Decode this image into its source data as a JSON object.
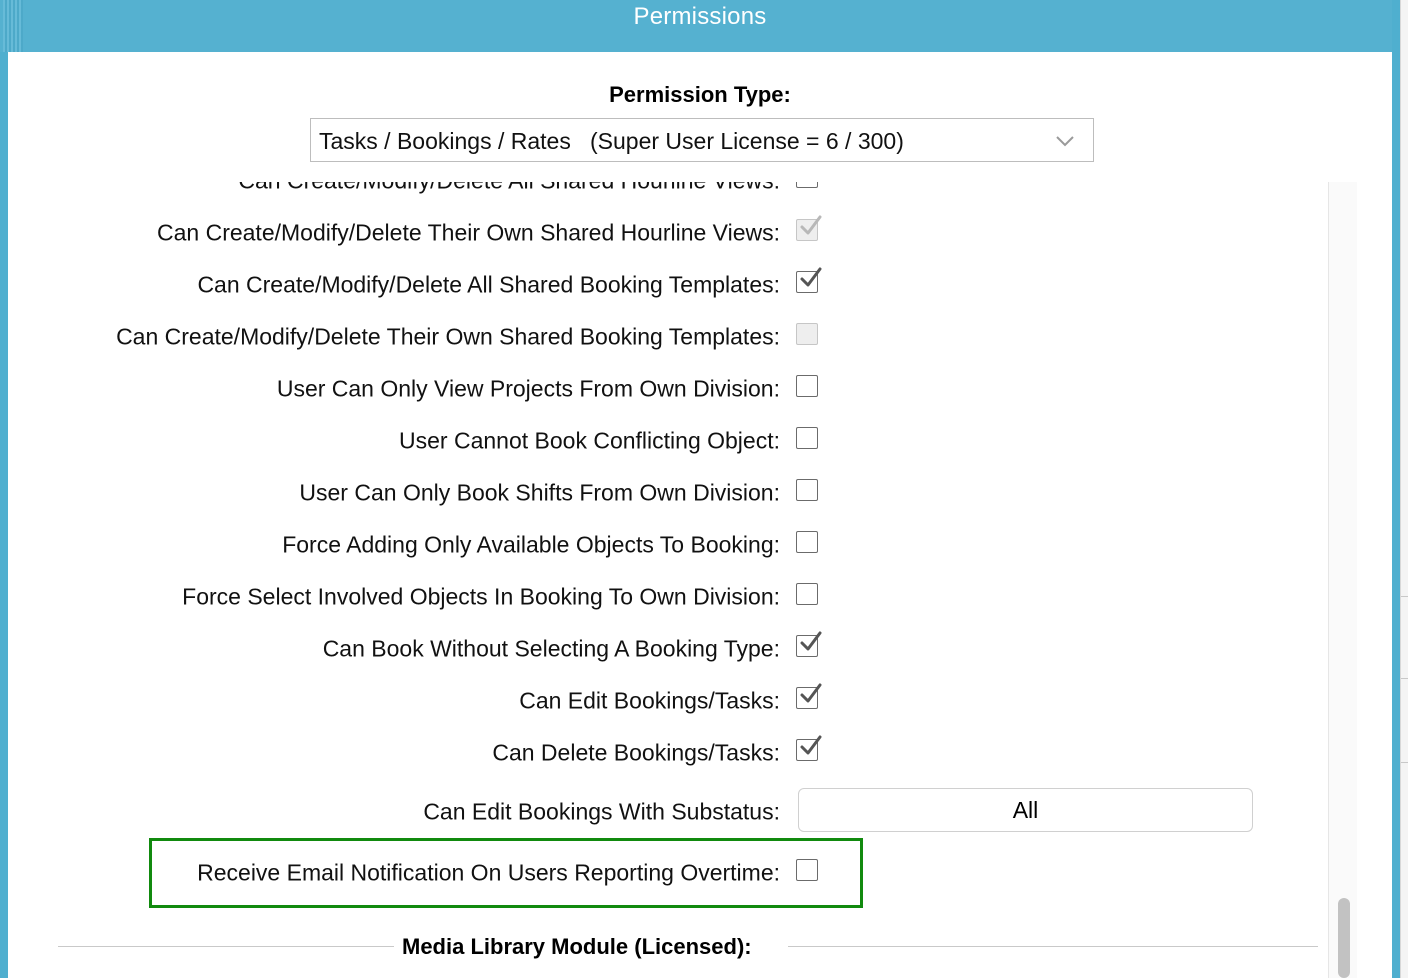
{
  "window": {
    "title": "Permissions"
  },
  "permission_type": {
    "label": "Permission Type:",
    "selected": "Tasks / Bookings / Rates   (Super User License = 6 / 300)"
  },
  "rows": [
    {
      "label": "Can Create/Modify/Delete All Shared Hourline Views:",
      "checked": false,
      "disabled": false
    },
    {
      "label": "Can Create/Modify/Delete Their Own Shared Hourline Views:",
      "checked": true,
      "disabled": true
    },
    {
      "label": "Can Create/Modify/Delete All Shared Booking Templates:",
      "checked": true,
      "disabled": false
    },
    {
      "label": "Can Create/Modify/Delete Their Own Shared Booking Templates:",
      "checked": false,
      "disabled": true
    },
    {
      "label": "User Can Only View Projects From Own Division:",
      "checked": false,
      "disabled": false
    },
    {
      "label": "User Cannot Book Conflicting Object:",
      "checked": false,
      "disabled": false
    },
    {
      "label": "User Can Only Book Shifts From Own Division:",
      "checked": false,
      "disabled": false
    },
    {
      "label": "Force Adding Only Available Objects To Booking:",
      "checked": false,
      "disabled": false
    },
    {
      "label": "Force Select Involved Objects In Booking To Own Division:",
      "checked": false,
      "disabled": false
    },
    {
      "label": "Can Book Without Selecting A Booking Type:",
      "checked": true,
      "disabled": false
    },
    {
      "label": "Can Edit Bookings/Tasks:",
      "checked": true,
      "disabled": false
    },
    {
      "label": "Can Delete Bookings/Tasks:",
      "checked": true,
      "disabled": false
    }
  ],
  "substatus": {
    "label": "Can Edit Bookings With Substatus:",
    "value": "All"
  },
  "overtime": {
    "label": "Receive Email Notification On Users Reporting Overtime:",
    "checked": false
  },
  "section_heading": "Media Library Module (Licensed):",
  "colors": {
    "titlebar": "#55b1d0",
    "highlight": "#118a0e",
    "checkbox_border": "#6b6b6b"
  }
}
